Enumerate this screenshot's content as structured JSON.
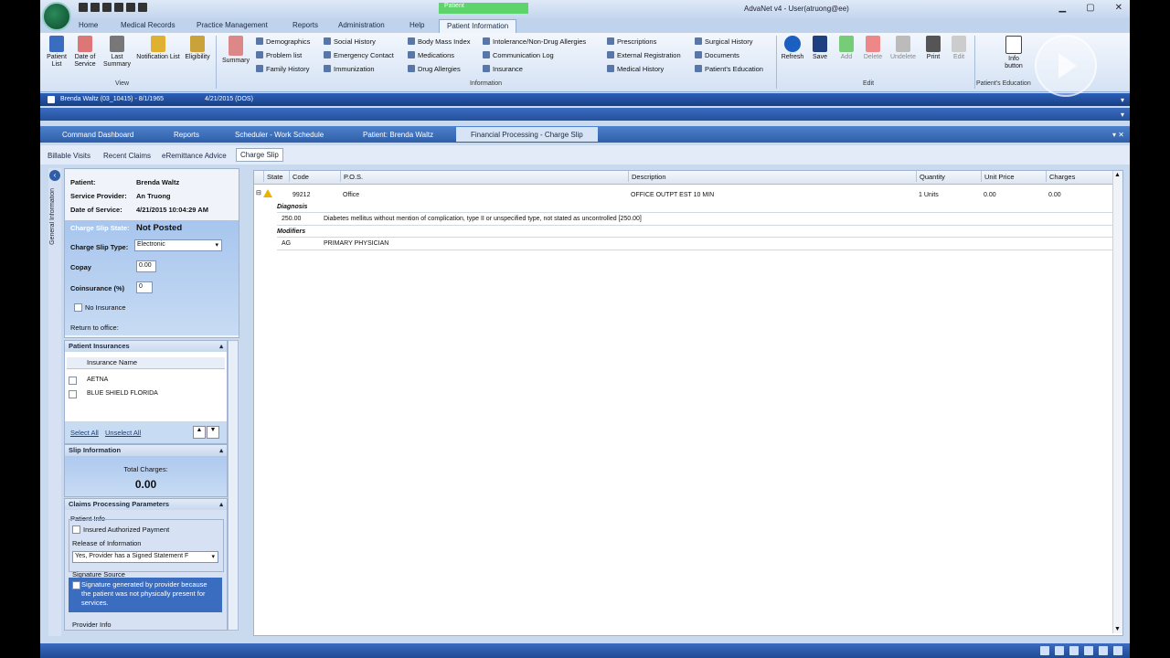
{
  "window": {
    "title": "AdvaNet v4 - User(atruong@ee)",
    "context_tab": "Patient"
  },
  "ribbon_tabs": [
    "Home",
    "Medical Records",
    "Practice Management",
    "Reports",
    "Administration",
    "Help",
    "Patient Information"
  ],
  "ribbon": {
    "view_buttons": [
      "Patient List",
      "Date of Service",
      "Last Summary",
      "Notification List",
      "Eligibility"
    ],
    "summary_label": "Summary",
    "info_items": {
      "col1": [
        "Demographics",
        "Problem list",
        "Family History"
      ],
      "col2": [
        "Social History",
        "Emergency Contact",
        "Immunization"
      ],
      "col3": [
        "Body Mass Index",
        "Medications",
        "Drug Allergies"
      ],
      "col4": [
        "Intolerance/Non-Drug Allergies",
        "Communication Log",
        "Insurance"
      ],
      "col5": [
        "Prescriptions",
        "External Registration",
        "Medical History"
      ],
      "col6": [
        "Surgical History",
        "Documents",
        "Patient's Education"
      ]
    },
    "edit_buttons": [
      "Refresh",
      "Save",
      "Add",
      "Delete",
      "Undelete",
      "Print",
      "Edit"
    ],
    "info_button": "Info button",
    "group_labels": {
      "view": "View",
      "information": "Information",
      "edit": "Edit",
      "education": "Patient's Education"
    }
  },
  "patient_bar": {
    "patient": "Brenda Waltz (03_10415) - 8/1/1965",
    "date": "4/21/2015 (DOS)"
  },
  "doc_tabs": [
    "Command Dashboard",
    "Reports",
    "Scheduler - Work Schedule",
    "Patient: Brenda Waltz",
    "Financial Processing - Charge Slip"
  ],
  "sub_tabs": [
    "Billable Visits",
    "Recent Claims",
    "eRemittance Advice",
    "Charge Slip"
  ],
  "side_title": "General Information",
  "general": {
    "patient_label": "Patient:",
    "patient": "Brenda Waltz",
    "provider_label": "Service Provider:",
    "provider": "An Truong",
    "dos_label": "Date of Service:",
    "dos": "4/21/2015 10:04:29 AM",
    "state_label": "Charge Slip State:",
    "state": "Not Posted",
    "type_label": "Charge Slip Type:",
    "type": "Electronic",
    "copay_label": "Copay",
    "copay": "0.00",
    "coins_label": "Coinsurance (%)",
    "coins": "0",
    "no_ins": "No Insurance",
    "return": "Return to office:"
  },
  "insurances": {
    "title": "Patient Insurances",
    "col": "Insurance Name",
    "rows": [
      "AETNA",
      "BLUE SHIELD FLORIDA"
    ],
    "select_all": "Select All",
    "unselect_all": "Unselect All"
  },
  "slip": {
    "title": "Slip Information",
    "total_label": "Total Charges:",
    "total": "0.00"
  },
  "claims": {
    "title": "Claims Processing Parameters",
    "patient_info": "Patient Info",
    "insured_auth": "Insured Authorized Payment",
    "release_label": "Release of Information",
    "release_value": "Yes, Provider has a Signed Statement F",
    "sig_label": "Signature Source",
    "sig_text": "Signature generated by provider because the patient was not physically present for services.",
    "provider_info": "Provider Info"
  },
  "grid": {
    "headers": [
      "State",
      "Code",
      "P.O.S.",
      "Description",
      "Quantity",
      "Unit Price",
      "Charges"
    ],
    "row": {
      "code": "99212",
      "pos": "Office",
      "description": "OFFICE OUTPT EST 10 MIN",
      "quantity": "1 Units",
      "unit_price": "0.00",
      "charges": "0.00"
    },
    "diag_label": "Diagnosis",
    "diag_code": "250.00",
    "diag_text": "Diabetes mellitus without mention of complication, type II or unspecified type, not stated as uncontrolled [250.00]",
    "mod_label": "Modifiers",
    "mod_code": "AG",
    "mod_text": "PRIMARY PHYSICIAN"
  }
}
